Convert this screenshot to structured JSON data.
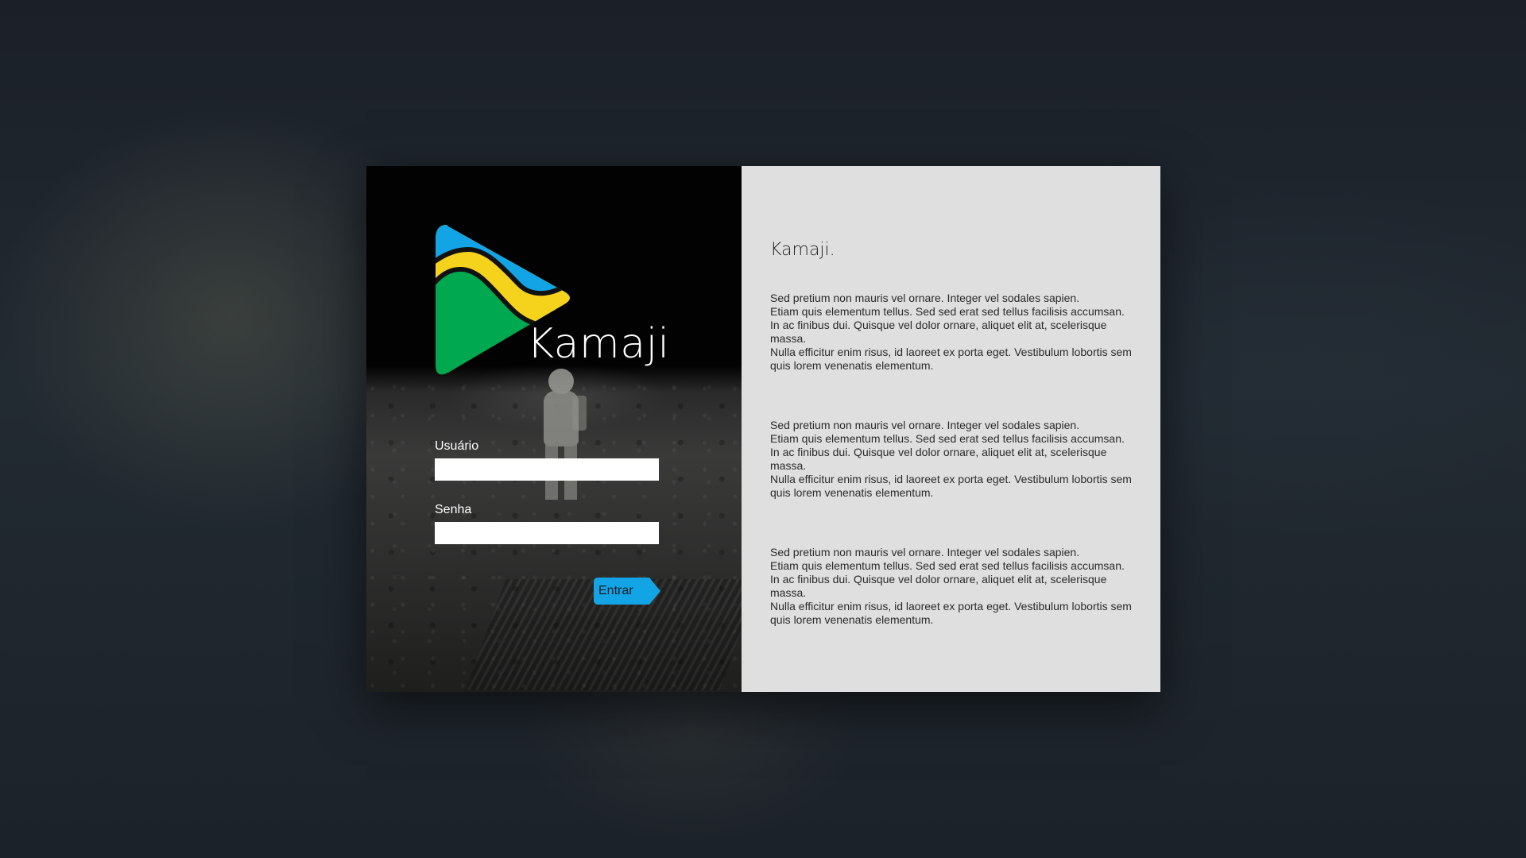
{
  "brand": {
    "name": "Kamaji",
    "logo_icon": "kamaji-logo-icon",
    "colors": {
      "blue": "#12a4e4",
      "yellow": "#f5d21c",
      "green": "#00a950",
      "outline": "#111111"
    }
  },
  "login_form": {
    "username_label": "Usuário",
    "username_value": "",
    "password_label": "Senha",
    "password_value": "",
    "submit_label": "Entrar"
  },
  "info_panel": {
    "title": "Kamaji.",
    "paragraphs": [
      "Sed pretium non mauris vel ornare. Integer vel sodales sapien.\nEtiam quis elementum tellus. Sed sed erat sed tellus facilisis accumsan.\nIn ac finibus dui. Quisque vel dolor ornare, aliquet elit at, scelerisque massa.\nNulla efficitur enim risus, id laoreet ex porta eget. Vestibulum lobortis sem\nquis lorem venenatis elementum.",
      "Sed pretium non mauris vel ornare. Integer vel sodales sapien.\nEtiam quis elementum tellus. Sed sed erat sed tellus facilisis accumsan.\nIn ac finibus dui. Quisque vel dolor ornare, aliquet elit at, scelerisque massa.\nNulla efficitur enim risus, id laoreet ex porta eget. Vestibulum lobortis sem\nquis lorem venenatis elementum.",
      "Sed pretium non mauris vel ornare. Integer vel sodales sapien.\nEtiam quis elementum tellus. Sed sed erat sed tellus facilisis accumsan.\nIn ac finibus dui. Quisque vel dolor ornare, aliquet elit at, scelerisque massa.\nNulla efficitur enim risus, id laoreet ex porta eget. Vestibulum lobortis sem\nquis lorem venenatis elementum."
    ]
  }
}
